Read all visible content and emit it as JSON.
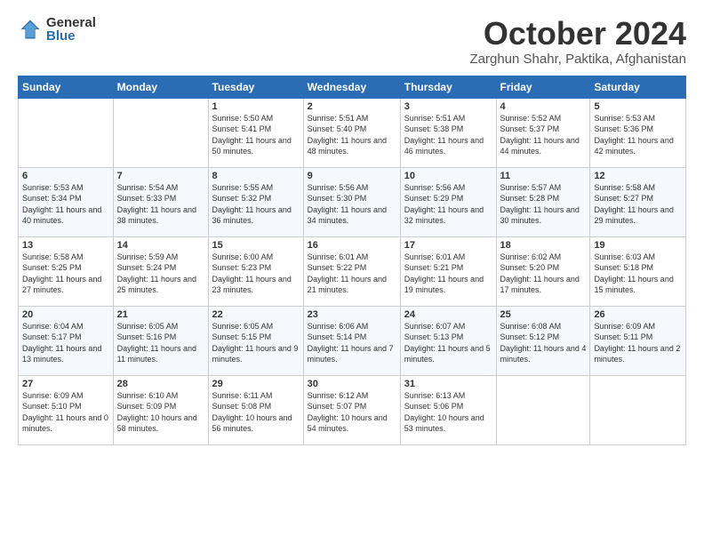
{
  "header": {
    "logo": {
      "general": "General",
      "blue": "Blue"
    },
    "title": "October 2024",
    "location": "Zarghun Shahr, Paktika, Afghanistan"
  },
  "weekdays": [
    "Sunday",
    "Monday",
    "Tuesday",
    "Wednesday",
    "Thursday",
    "Friday",
    "Saturday"
  ],
  "weeks": [
    [
      {
        "day": "",
        "info": ""
      },
      {
        "day": "",
        "info": ""
      },
      {
        "day": "1",
        "info": "Sunrise: 5:50 AM\nSunset: 5:41 PM\nDaylight: 11 hours and 50 minutes."
      },
      {
        "day": "2",
        "info": "Sunrise: 5:51 AM\nSunset: 5:40 PM\nDaylight: 11 hours and 48 minutes."
      },
      {
        "day": "3",
        "info": "Sunrise: 5:51 AM\nSunset: 5:38 PM\nDaylight: 11 hours and 46 minutes."
      },
      {
        "day": "4",
        "info": "Sunrise: 5:52 AM\nSunset: 5:37 PM\nDaylight: 11 hours and 44 minutes."
      },
      {
        "day": "5",
        "info": "Sunrise: 5:53 AM\nSunset: 5:36 PM\nDaylight: 11 hours and 42 minutes."
      }
    ],
    [
      {
        "day": "6",
        "info": "Sunrise: 5:53 AM\nSunset: 5:34 PM\nDaylight: 11 hours and 40 minutes."
      },
      {
        "day": "7",
        "info": "Sunrise: 5:54 AM\nSunset: 5:33 PM\nDaylight: 11 hours and 38 minutes."
      },
      {
        "day": "8",
        "info": "Sunrise: 5:55 AM\nSunset: 5:32 PM\nDaylight: 11 hours and 36 minutes."
      },
      {
        "day": "9",
        "info": "Sunrise: 5:56 AM\nSunset: 5:30 PM\nDaylight: 11 hours and 34 minutes."
      },
      {
        "day": "10",
        "info": "Sunrise: 5:56 AM\nSunset: 5:29 PM\nDaylight: 11 hours and 32 minutes."
      },
      {
        "day": "11",
        "info": "Sunrise: 5:57 AM\nSunset: 5:28 PM\nDaylight: 11 hours and 30 minutes."
      },
      {
        "day": "12",
        "info": "Sunrise: 5:58 AM\nSunset: 5:27 PM\nDaylight: 11 hours and 29 minutes."
      }
    ],
    [
      {
        "day": "13",
        "info": "Sunrise: 5:58 AM\nSunset: 5:25 PM\nDaylight: 11 hours and 27 minutes."
      },
      {
        "day": "14",
        "info": "Sunrise: 5:59 AM\nSunset: 5:24 PM\nDaylight: 11 hours and 25 minutes."
      },
      {
        "day": "15",
        "info": "Sunrise: 6:00 AM\nSunset: 5:23 PM\nDaylight: 11 hours and 23 minutes."
      },
      {
        "day": "16",
        "info": "Sunrise: 6:01 AM\nSunset: 5:22 PM\nDaylight: 11 hours and 21 minutes."
      },
      {
        "day": "17",
        "info": "Sunrise: 6:01 AM\nSunset: 5:21 PM\nDaylight: 11 hours and 19 minutes."
      },
      {
        "day": "18",
        "info": "Sunrise: 6:02 AM\nSunset: 5:20 PM\nDaylight: 11 hours and 17 minutes."
      },
      {
        "day": "19",
        "info": "Sunrise: 6:03 AM\nSunset: 5:18 PM\nDaylight: 11 hours and 15 minutes."
      }
    ],
    [
      {
        "day": "20",
        "info": "Sunrise: 6:04 AM\nSunset: 5:17 PM\nDaylight: 11 hours and 13 minutes."
      },
      {
        "day": "21",
        "info": "Sunrise: 6:05 AM\nSunset: 5:16 PM\nDaylight: 11 hours and 11 minutes."
      },
      {
        "day": "22",
        "info": "Sunrise: 6:05 AM\nSunset: 5:15 PM\nDaylight: 11 hours and 9 minutes."
      },
      {
        "day": "23",
        "info": "Sunrise: 6:06 AM\nSunset: 5:14 PM\nDaylight: 11 hours and 7 minutes."
      },
      {
        "day": "24",
        "info": "Sunrise: 6:07 AM\nSunset: 5:13 PM\nDaylight: 11 hours and 5 minutes."
      },
      {
        "day": "25",
        "info": "Sunrise: 6:08 AM\nSunset: 5:12 PM\nDaylight: 11 hours and 4 minutes."
      },
      {
        "day": "26",
        "info": "Sunrise: 6:09 AM\nSunset: 5:11 PM\nDaylight: 11 hours and 2 minutes."
      }
    ],
    [
      {
        "day": "27",
        "info": "Sunrise: 6:09 AM\nSunset: 5:10 PM\nDaylight: 11 hours and 0 minutes."
      },
      {
        "day": "28",
        "info": "Sunrise: 6:10 AM\nSunset: 5:09 PM\nDaylight: 10 hours and 58 minutes."
      },
      {
        "day": "29",
        "info": "Sunrise: 6:11 AM\nSunset: 5:08 PM\nDaylight: 10 hours and 56 minutes."
      },
      {
        "day": "30",
        "info": "Sunrise: 6:12 AM\nSunset: 5:07 PM\nDaylight: 10 hours and 54 minutes."
      },
      {
        "day": "31",
        "info": "Sunrise: 6:13 AM\nSunset: 5:06 PM\nDaylight: 10 hours and 53 minutes."
      },
      {
        "day": "",
        "info": ""
      },
      {
        "day": "",
        "info": ""
      }
    ]
  ]
}
